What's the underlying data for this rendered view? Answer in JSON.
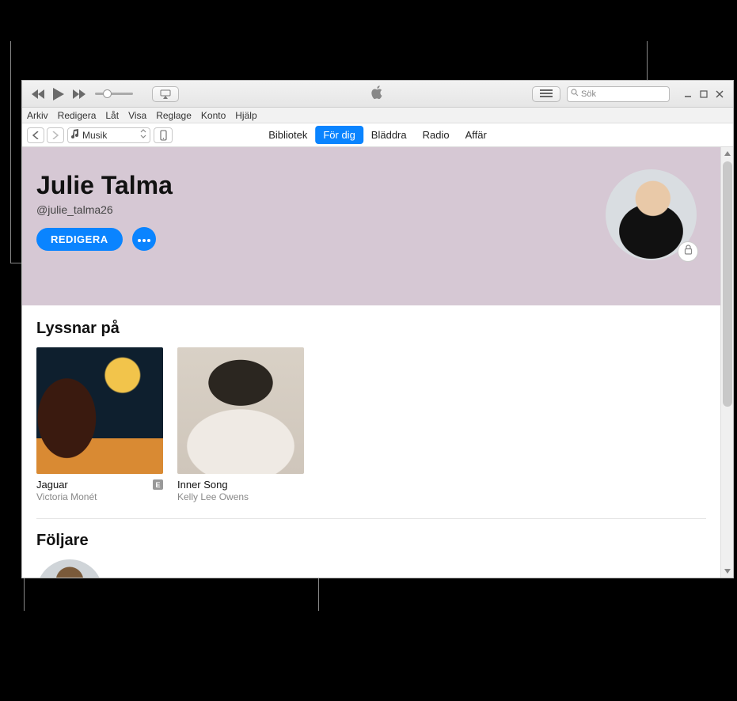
{
  "search": {
    "placeholder": "Sök"
  },
  "menu": {
    "items": [
      "Arkiv",
      "Redigera",
      "Låt",
      "Visa",
      "Reglage",
      "Konto",
      "Hjälp"
    ]
  },
  "media_selector": {
    "label": "Musik"
  },
  "tabs": {
    "items": [
      "Bibliotek",
      "För dig",
      "Bläddra",
      "Radio",
      "Affär"
    ],
    "active": "För dig"
  },
  "profile": {
    "name": "Julie Talma",
    "handle": "@julie_talma26",
    "edit_label": "REDIGERA"
  },
  "sections": {
    "listening": {
      "title": "Lyssnar på",
      "albums": [
        {
          "title": "Jaguar",
          "artist": "Victoria Monét",
          "explicit_badge": "E"
        },
        {
          "title": "Inner Song",
          "artist": "Kelly Lee Owens"
        }
      ]
    },
    "followers": {
      "title": "Följare"
    }
  }
}
